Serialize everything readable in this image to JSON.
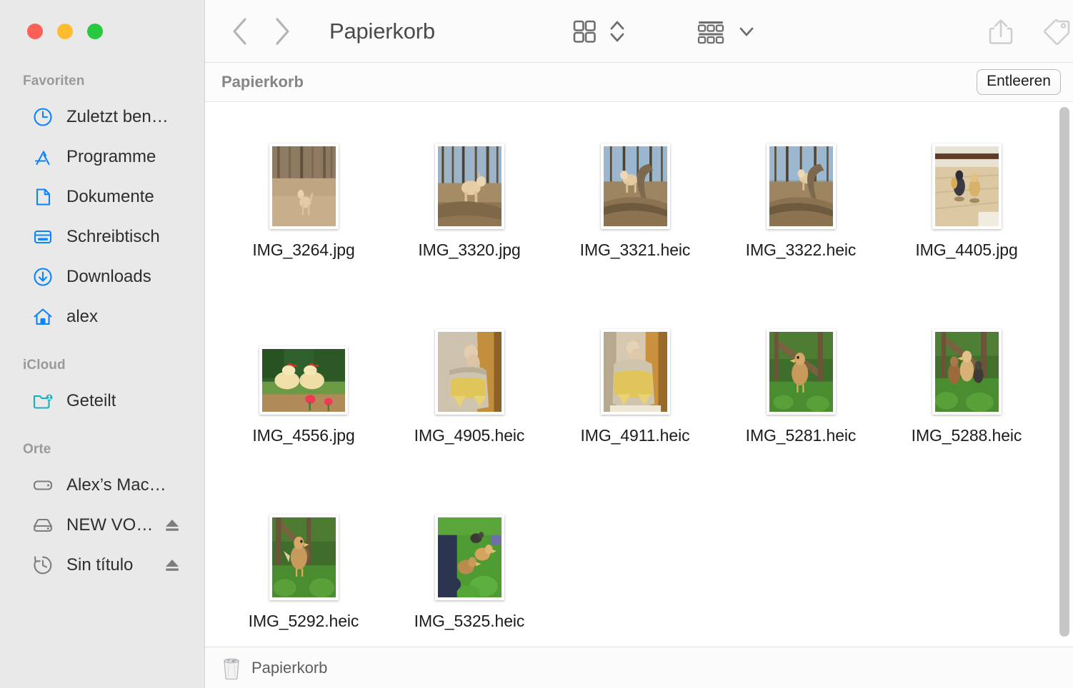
{
  "window": {
    "title": "Papierkorb",
    "traffic_lights": [
      {
        "name": "close",
        "color": "#ff5f57"
      },
      {
        "name": "minimize",
        "color": "#febc2e"
      },
      {
        "name": "zoom",
        "color": "#28c840"
      }
    ]
  },
  "toolbar": {
    "back_icon": "chevron-left-icon",
    "forward_icon": "chevron-right-icon",
    "title": "Papierkorb",
    "view_icon": "icon-view-grid-icon",
    "view_stepper_icon": "chevron-up-down-icon",
    "group_icon": "group-by-icon",
    "group_chevron_icon": "chevron-down-icon",
    "share_icon": "share-icon",
    "tag_icon": "tag-icon",
    "more_icon": "ellipsis-circle-icon",
    "more_chevron_icon": "chevron-down-icon",
    "search_icon": "search-icon"
  },
  "pathheader": {
    "title": "Papierkorb",
    "empty_button": "Entleeren"
  },
  "sidebar": {
    "sections": [
      {
        "header": "Favoriten",
        "items": [
          {
            "label": "Zuletzt ben…",
            "icon": "clock-icon",
            "tint": "#0a84ff",
            "eject": false
          },
          {
            "label": "Programme",
            "icon": "applications-icon",
            "tint": "#0a84ff",
            "eject": false
          },
          {
            "label": "Dokumente",
            "icon": "document-icon",
            "tint": "#0a84ff",
            "eject": false
          },
          {
            "label": "Schreibtisch",
            "icon": "desktop-icon",
            "tint": "#0a84ff",
            "eject": false
          },
          {
            "label": "Downloads",
            "icon": "downloads-icon",
            "tint": "#0a84ff",
            "eject": false
          },
          {
            "label": "alex",
            "icon": "home-icon",
            "tint": "#0a84ff",
            "eject": false
          }
        ]
      },
      {
        "header": "iCloud",
        "items": [
          {
            "label": "Geteilt",
            "icon": "shared-folder-icon",
            "tint": "#14b0c4",
            "eject": false
          }
        ]
      },
      {
        "header": "Orte",
        "items": [
          {
            "label": "Alex’s Mac…",
            "icon": "computer-icon",
            "tint": "#7d7d7d",
            "eject": false
          },
          {
            "label": "NEW VO…",
            "icon": "external-drive-icon",
            "tint": "#7d7d7d",
            "eject": true
          },
          {
            "label": "Sin título",
            "icon": "time-machine-icon",
            "tint": "#7d7d7d",
            "eject": true
          }
        ]
      }
    ]
  },
  "files": [
    {
      "name": "IMG_3264.jpg",
      "orientation": "portrait",
      "scene": "dog-forest-field"
    },
    {
      "name": "IMG_3320.jpg",
      "orientation": "portrait",
      "scene": "dog-on-log-a"
    },
    {
      "name": "IMG_3321.heic",
      "orientation": "portrait",
      "scene": "dog-on-log-b"
    },
    {
      "name": "IMG_3322.heic",
      "orientation": "portrait",
      "scene": "dog-on-log-c"
    },
    {
      "name": "IMG_4405.jpg",
      "orientation": "portrait",
      "scene": "chicks-on-floor"
    },
    {
      "name": "IMG_4556.jpg",
      "orientation": "landscape",
      "scene": "chickens-tulips"
    },
    {
      "name": "IMG_4905.heic",
      "orientation": "portrait",
      "scene": "cat-on-basket-a"
    },
    {
      "name": "IMG_4911.heic",
      "orientation": "portrait",
      "scene": "cat-on-basket-b"
    },
    {
      "name": "IMG_5281.heic",
      "orientation": "portrait",
      "scene": "chick-in-grass-a"
    },
    {
      "name": "IMG_5288.heic",
      "orientation": "portrait",
      "scene": "chicks-in-coop"
    },
    {
      "name": "IMG_5292.heic",
      "orientation": "portrait",
      "scene": "chick-in-grass-b"
    },
    {
      "name": "IMG_5325.heic",
      "orientation": "portrait",
      "scene": "ducklings-grass"
    }
  ],
  "statusbar": {
    "icon": "trash-icon",
    "text": "Papierkorb"
  },
  "scrollbar": {
    "orientation": "vertical",
    "thumb_color": "#c6c6c6"
  },
  "colors": {
    "accent": "#0a84ff",
    "sidebar_bg": "#e9e9e9",
    "toolbar_bg": "#fbfbfb",
    "content_bg": "#ffffff"
  }
}
